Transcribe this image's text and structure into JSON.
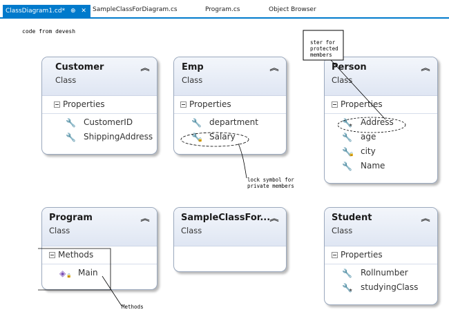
{
  "tabs": [
    {
      "label": "ClassDiagram1.cd*",
      "active": true
    },
    {
      "label": "SampleClassForDiagram.cs",
      "active": false
    },
    {
      "label": "Program.cs",
      "active": false
    },
    {
      "label": "Object Browser",
      "active": false
    }
  ],
  "tab_icons": {
    "pin": "pin-icon",
    "close": "close-icon"
  },
  "caption": "code from devesh",
  "shapes": {
    "customer": {
      "title": "Customer",
      "subtitle": "Class",
      "section": "Properties",
      "members": [
        "CustomerID",
        "ShippingAddress"
      ]
    },
    "emp": {
      "title": "Emp",
      "subtitle": "Class",
      "section": "Properties",
      "members": [
        "department",
        "Salary"
      ]
    },
    "person": {
      "title": "Person",
      "subtitle": "Class",
      "section": "Properties",
      "members": [
        "Address",
        "age",
        "city",
        "Name"
      ]
    },
    "program": {
      "title": "Program",
      "subtitle": "Class",
      "section": "Methods",
      "members": [
        "Main"
      ]
    },
    "sample": {
      "title": "SampleClassFor...",
      "subtitle": "Class"
    },
    "student": {
      "title": "Student",
      "subtitle": "Class",
      "section": "Properties",
      "members": [
        "Rollnumber",
        "studyingClass"
      ]
    }
  },
  "annotations": {
    "protected": [
      "ster for",
      "protected",
      "members"
    ],
    "private": [
      "lock symbol for",
      "private members"
    ],
    "methods": "Methods"
  },
  "colors": {
    "tab_accent": "#007acc",
    "shape_border": "#9aa8bd",
    "method_icon": "#7a4fb3"
  }
}
